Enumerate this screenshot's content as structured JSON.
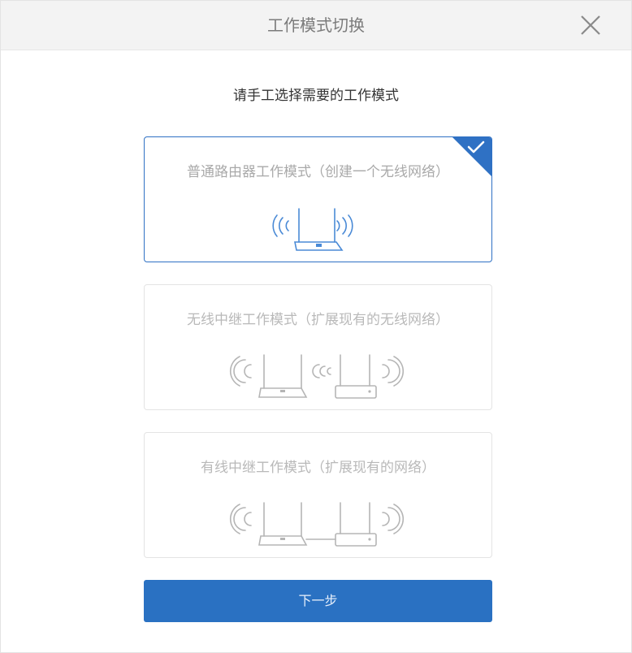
{
  "dialog": {
    "title": "工作模式切换",
    "close_icon": "close-icon",
    "subtitle": "请手工选择需要的工作模式"
  },
  "modes": [
    {
      "label": "普通路由器工作模式（创建一个无线网络）",
      "selected": true,
      "icon": "router-wifi-icon"
    },
    {
      "label": "无线中继工作模式（扩展现有的无线网络）",
      "selected": false,
      "icon": "wireless-repeater-icon"
    },
    {
      "label": "有线中继工作模式（扩展现有的网络）",
      "selected": false,
      "icon": "wired-repeater-icon"
    }
  ],
  "next_button": {
    "label": "下一步"
  },
  "colors": {
    "accent": "#2a71c2",
    "selected_border": "#2f71c4",
    "unselected_border": "#e4e4e4",
    "header_bg": "#f3f3f3"
  }
}
